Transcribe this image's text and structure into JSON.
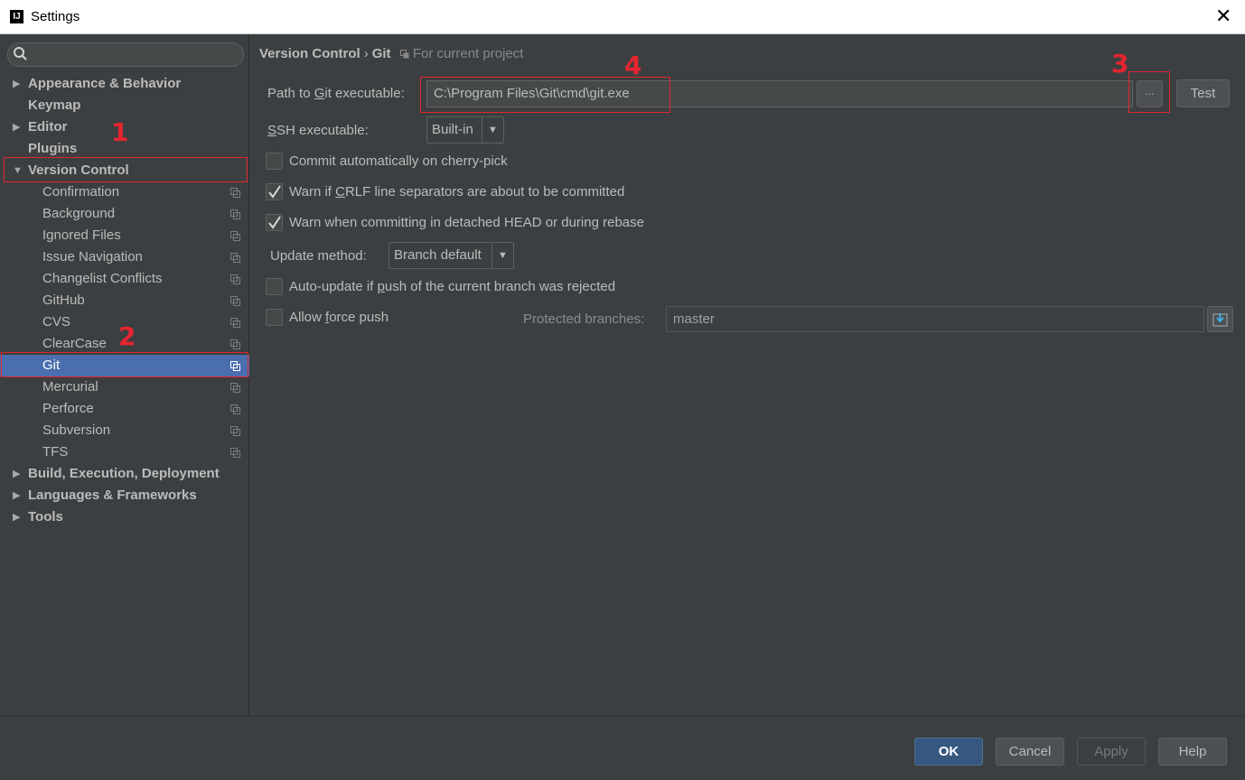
{
  "window": {
    "title": "Settings",
    "app_icon_text": "IJ"
  },
  "sidebar": {
    "search_placeholder": "",
    "items": [
      {
        "label": "Appearance & Behavior",
        "level": 0,
        "expandable": true,
        "expanded": false
      },
      {
        "label": "Keymap",
        "level": 0
      },
      {
        "label": "Editor",
        "level": 0,
        "expandable": true,
        "expanded": false
      },
      {
        "label": "Plugins",
        "level": 0
      },
      {
        "label": "Version Control",
        "level": 0,
        "expandable": true,
        "expanded": true
      },
      {
        "label": "Confirmation",
        "level": 1
      },
      {
        "label": "Background",
        "level": 1
      },
      {
        "label": "Ignored Files",
        "level": 1
      },
      {
        "label": "Issue Navigation",
        "level": 1
      },
      {
        "label": "Changelist Conflicts",
        "level": 1
      },
      {
        "label": "GitHub",
        "level": 1
      },
      {
        "label": "CVS",
        "level": 1
      },
      {
        "label": "ClearCase",
        "level": 1
      },
      {
        "label": "Git",
        "level": 1,
        "selected": true
      },
      {
        "label": "Mercurial",
        "level": 1
      },
      {
        "label": "Perforce",
        "level": 1
      },
      {
        "label": "Subversion",
        "level": 1
      },
      {
        "label": "TFS",
        "level": 1
      },
      {
        "label": "Build, Execution, Deployment",
        "level": 0,
        "expandable": true,
        "expanded": false
      },
      {
        "label": "Languages & Frameworks",
        "level": 0,
        "expandable": true,
        "expanded": false
      },
      {
        "label": "Tools",
        "level": 0,
        "expandable": true,
        "expanded": false
      }
    ]
  },
  "annotations": {
    "n1": "1",
    "n2": "2",
    "n3": "3",
    "n4": "4"
  },
  "content": {
    "breadcrumb": {
      "parent": "Version Control",
      "separator": "›",
      "current": "Git",
      "scope": "For current project"
    },
    "path_label_pre": "Path to ",
    "path_label_u": "G",
    "path_label_post": "it executable:",
    "path_value": "C:\\Program Files\\Git\\cmd\\git.exe",
    "browse_label": "...",
    "test_label": "Test",
    "ssh_label_u": "S",
    "ssh_label_post": "SH executable:",
    "ssh_value": "Built-in",
    "cb_cherry": {
      "label": "Commit automatically on cherry-pick",
      "checked": false
    },
    "cb_crlf": {
      "pre": "Warn if ",
      "u": "C",
      "post": "RLF line separators are about to be committed",
      "checked": true
    },
    "cb_detached": {
      "label": "Warn when committing in detached HEAD or during rebase",
      "checked": true
    },
    "update_label": "Update method:",
    "update_value": "Branch default",
    "cb_autoupdate": {
      "pre": "Auto-update if ",
      "u": "p",
      "post": "ush of the current branch was rejected",
      "checked": false
    },
    "cb_force": {
      "pre": "Allow ",
      "u": "f",
      "post": "orce push",
      "checked": false
    },
    "protected_label": "Protected branches:",
    "protected_value": "master"
  },
  "footer": {
    "ok": "OK",
    "cancel": "Cancel",
    "apply": "Apply",
    "help": "Help"
  },
  "colors": {
    "selection": "#4b6eaf",
    "annotation_red": "#e0262f",
    "background": "#3c3f41"
  }
}
